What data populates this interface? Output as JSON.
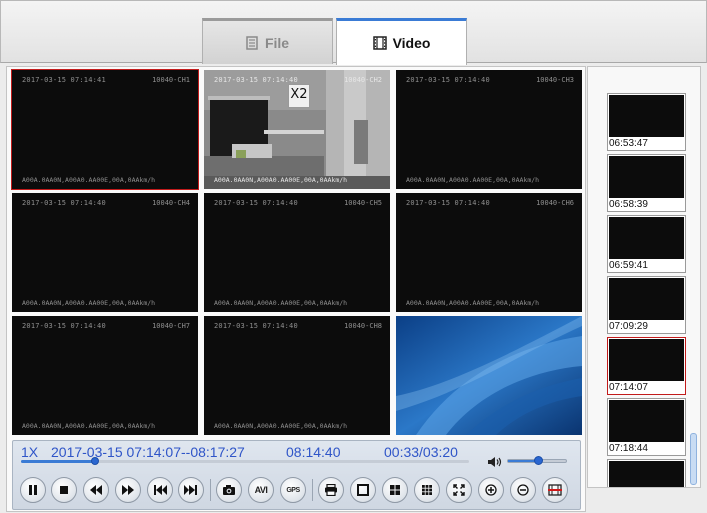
{
  "tabs": [
    {
      "label": "File",
      "icon": "file-list-icon",
      "active": false
    },
    {
      "label": "Video",
      "icon": "film-icon",
      "active": true
    }
  ],
  "cells": [
    {
      "timestamp": "2017-03-15 07:14:41",
      "channel": "10040-CH1",
      "gps": "A00A.0AA0N,A00A0.AA00E,00A,0AAkm/h",
      "selected": true
    },
    {
      "timestamp": "2017-03-15 07:14:40",
      "channel": "10040-CH2",
      "gps": "A00A.0AA0N,A00A0.AA00E,00A,0AAkm/h",
      "badge": "X2",
      "selected": false
    },
    {
      "timestamp": "2017-03-15 07:14:40",
      "channel": "10040-CH3",
      "gps": "A00A.0AA0N,A00A0.AA00E,00A,0AAkm/h",
      "selected": false
    },
    {
      "timestamp": "2017-03-15 07:14:40",
      "channel": "10040-CH4",
      "gps": "A00A.0AA0N,A00A0.AA00E,00A,0AAkm/h",
      "selected": false
    },
    {
      "timestamp": "2017-03-15 07:14:40",
      "channel": "10040-CH5",
      "gps": "A00A.0AA0N,A00A0.AA00E,00A,0AAkm/h",
      "selected": false
    },
    {
      "timestamp": "2017-03-15 07:14:40",
      "channel": "10040-CH6",
      "gps": "A00A.0AA0N,A00A0.AA00E,00A,0AAkm/h",
      "selected": false
    },
    {
      "timestamp": "2017-03-15 07:14:40",
      "channel": "10040-CH7",
      "gps": "A00A.0AA0N,A00A0.AA00E,00A,0AAkm/h",
      "selected": false
    },
    {
      "timestamp": "2017-03-15 07:14:40",
      "channel": "10040-CH8",
      "gps": "A00A.0AA0N,A00A0.AA00E,00A,0AAkm/h",
      "selected": false
    }
  ],
  "playback": {
    "speed": "1X",
    "time_range": "2017-03-15 07:14:07--08:17:27",
    "current_time": "08:14:40",
    "position": "00:33/03:20",
    "progress_fraction": 0.165,
    "volume_fraction": 0.52
  },
  "buttons": [
    {
      "name": "pause-button",
      "icon": "pause-icon"
    },
    {
      "name": "stop-button",
      "icon": "stop-icon"
    },
    {
      "name": "rewind-button",
      "icon": "rewind-icon"
    },
    {
      "name": "fast-forward-button",
      "icon": "fast-forward-icon"
    },
    {
      "name": "previous-frame-button",
      "icon": "skip-back-icon"
    },
    {
      "name": "next-frame-button",
      "icon": "skip-forward-icon"
    },
    {
      "name": "snapshot-button",
      "icon": "camera-icon"
    },
    {
      "name": "avi-export-button",
      "label": "AVI"
    },
    {
      "name": "gps-button",
      "label": "GPS"
    },
    {
      "name": "print-button",
      "icon": "printer-icon"
    },
    {
      "name": "layout-single-button",
      "icon": "layout-1-icon"
    },
    {
      "name": "layout-quad-button",
      "icon": "layout-4-icon"
    },
    {
      "name": "layout-nine-button",
      "icon": "layout-9-icon"
    },
    {
      "name": "fullscreen-button",
      "icon": "fullscreen-icon"
    },
    {
      "name": "zoom-in-button",
      "icon": "zoom-in-icon"
    },
    {
      "name": "zoom-out-button",
      "icon": "zoom-out-icon"
    },
    {
      "name": "clip-button",
      "icon": "film-cut-icon"
    }
  ],
  "thumbnails": [
    {
      "time": "06:53:47",
      "selected": false
    },
    {
      "time": "06:58:39",
      "selected": false
    },
    {
      "time": "06:59:41",
      "selected": false
    },
    {
      "time": "07:09:29",
      "selected": false
    },
    {
      "time": "07:14:07",
      "selected": true
    },
    {
      "time": "07:18:44",
      "selected": false
    },
    {
      "time": "",
      "selected": false
    }
  ],
  "colors": {
    "accent": "#3a7bd5",
    "info_text": "#2f55c8",
    "selection": "#c21b1b"
  }
}
